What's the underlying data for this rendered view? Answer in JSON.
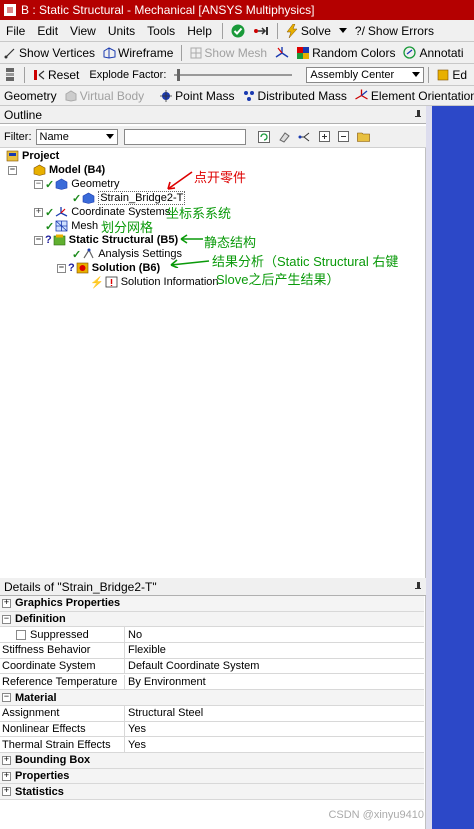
{
  "window": {
    "title": "B : Static Structural - Mechanical [ANSYS Multiphysics]"
  },
  "menu": {
    "items": [
      "File",
      "Edit",
      "View",
      "Units",
      "Tools",
      "Help"
    ],
    "solve": "Solve",
    "show_errors": "Show Errors"
  },
  "toolbar2": {
    "show_vertices": "Show Vertices",
    "wireframe": "Wireframe",
    "show_mesh": "Show Mesh",
    "random_colors": "Random Colors",
    "annotations": "Annotati"
  },
  "toolbar3": {
    "reset": "Reset",
    "explode_label": "Explode Factor:",
    "assembly_center": "Assembly Center",
    "edit": "Ed"
  },
  "toolbar4": {
    "geometry": "Geometry",
    "virtual_body": "Virtual Body",
    "point_mass": "Point Mass",
    "distributed_mass": "Distributed Mass",
    "element_orientation": "Element Orientation"
  },
  "outline": {
    "title": "Outline",
    "filter_label": "Filter:",
    "filter_value": "Name",
    "search_value": "",
    "tree": {
      "project": "Project",
      "model": "Model (B4)",
      "geometry": "Geometry",
      "body": "Strain_Bridge2-T",
      "coordinate_systems": "Coordinate Systems",
      "mesh": "Mesh",
      "static_structural": "Static Structural (B5)",
      "analysis_settings": "Analysis Settings",
      "solution": "Solution (B6)",
      "solution_information": "Solution Information"
    },
    "annotations": {
      "click_part": "点开零件",
      "coord_system": "坐标系系统",
      "mesh": "划分网格",
      "static_structure": "静态结构",
      "result_line1": "结果分析（Static Structural 右键",
      "result_line2": "Slove之后产生结果）"
    }
  },
  "details": {
    "title": "Details of \"Strain_Bridge2-T\"",
    "groups": {
      "graphics_properties": "Graphics Properties",
      "definition": "Definition",
      "material": "Material",
      "bounding_box": "Bounding Box",
      "properties": "Properties",
      "statistics": "Statistics"
    },
    "rows": {
      "suppressed": {
        "name": "Suppressed",
        "value": "No"
      },
      "stiffness": {
        "name": "Stiffness Behavior",
        "value": "Flexible"
      },
      "coord": {
        "name": "Coordinate System",
        "value": "Default Coordinate System"
      },
      "ref_temp": {
        "name": "Reference Temperature",
        "value": "By Environment"
      },
      "assignment": {
        "name": "Assignment",
        "value": "Structural Steel"
      },
      "nonlinear": {
        "name": "Nonlinear Effects",
        "value": "Yes"
      },
      "thermal": {
        "name": "Thermal Strain Effects",
        "value": "Yes"
      }
    }
  },
  "watermark": "CSDN @xinyu9410"
}
